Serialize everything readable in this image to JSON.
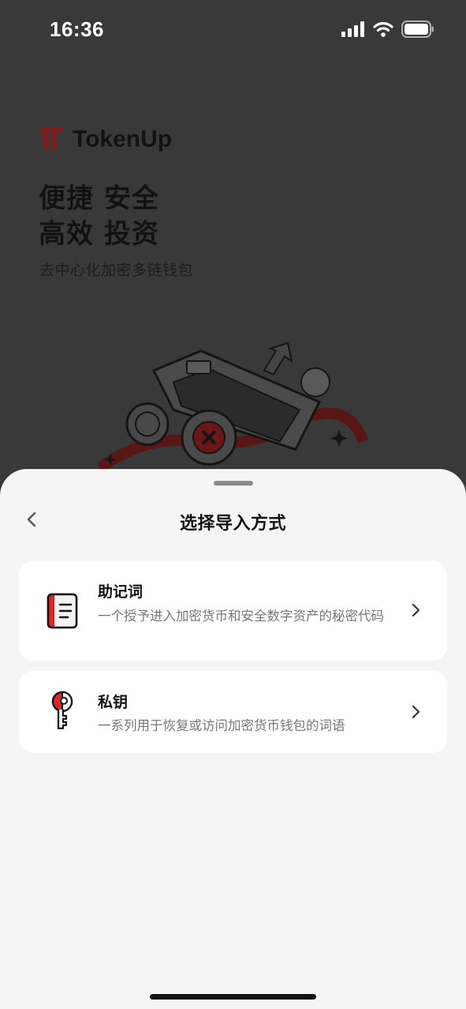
{
  "status_bar": {
    "time": "16:36",
    "icons": [
      "signal-icon",
      "wifi-icon",
      "battery-icon"
    ]
  },
  "brand": {
    "name": "TokenUp",
    "logo_icon": "tokenup-logo-icon",
    "logo_color": "#8b1a1a"
  },
  "hero": {
    "headline_line1": "便捷 安全",
    "headline_line2": "高效 投资",
    "subtitle": "去中心化加密多链钱包"
  },
  "sheet": {
    "title": "选择导入方式",
    "back_icon": "chevron-left-icon",
    "options": [
      {
        "title": "助记词",
        "description": "一个授予进入加密货币和安全数字资产的秘密代码",
        "icon": "document-icon",
        "action_icon": "chevron-right-icon"
      },
      {
        "title": "私钥",
        "description": "一系列用于恢复或访问加密货币钱包的词语",
        "icon": "key-icon",
        "action_icon": "chevron-right-icon"
      }
    ]
  },
  "colors": {
    "accent": "#e0262b",
    "background_dim": "#393939",
    "sheet_bg": "#f5f5f5",
    "card_bg": "#ffffff"
  }
}
